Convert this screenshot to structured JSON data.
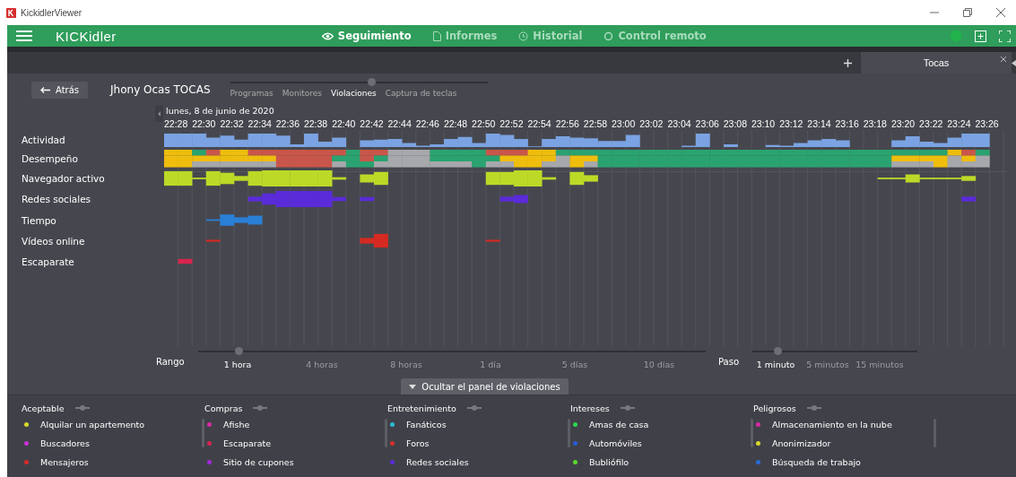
{
  "window": {
    "title": "KickidlerViewer"
  },
  "app_bar": {
    "logo": "KICKidler",
    "nav": [
      {
        "label": "Seguimiento",
        "selected": true,
        "kind": "eye"
      },
      {
        "label": "Informes",
        "selected": false,
        "kind": "doc"
      },
      {
        "label": "Historial",
        "selected": false,
        "kind": "history"
      },
      {
        "label": "Control remoto",
        "selected": false,
        "kind": "remote"
      }
    ]
  },
  "tabs": [
    {
      "label": "Tocas",
      "selected": true
    }
  ],
  "toolbar": {
    "back": "Atrás",
    "employee": "Jhony Ocas TOCAS",
    "view": {
      "level": 0.55,
      "options": [
        {
          "label": "Programas",
          "selected": false
        },
        {
          "label": "Monitores",
          "selected": false
        },
        {
          "label": "Violaciones",
          "selected": true
        },
        {
          "label": "Captura de teclas",
          "selected": false
        }
      ]
    }
  },
  "timeline": {
    "date": "lunes, 8 de junio de 2020",
    "times": [
      "22:28",
      "22:30",
      "22:32",
      "22:34",
      "22:36",
      "22:38",
      "22:40",
      "22:42",
      "22:44",
      "22:46",
      "22:48",
      "22:50",
      "22:52",
      "22:54",
      "22:56",
      "22:58",
      "23:00",
      "23:02",
      "23:04",
      "23:06",
      "23:08",
      "23:10",
      "23:12",
      "23:14",
      "23:16",
      "23:18",
      "23:20",
      "23:22",
      "23:24",
      "23:26"
    ],
    "lanes": [
      {
        "label": "Actividad",
        "kind": "activity"
      },
      {
        "label": "Desempeño",
        "kind": "performance"
      },
      {
        "label": "Navegador activo",
        "kind": "category",
        "color": "#bcd927"
      },
      {
        "label": "Redes sociales",
        "kind": "category",
        "color": "#5a2bd8"
      },
      {
        "label": "Tiempo",
        "kind": "category",
        "color": "#2a7fd6"
      },
      {
        "label": "Vídeos online",
        "kind": "category",
        "color": "#d42a22"
      },
      {
        "label": "Escaparate",
        "kind": "category",
        "color": "#d8244e"
      }
    ]
  },
  "range": {
    "label": "Rango",
    "level": 0.08,
    "options": [
      {
        "label": "1 hora",
        "selected": true
      },
      {
        "label": "4 horas",
        "selected": false
      },
      {
        "label": "8 horas",
        "selected": false
      },
      {
        "label": "1 día",
        "selected": false
      },
      {
        "label": "5 días",
        "selected": false
      },
      {
        "label": "10 días",
        "selected": false
      }
    ]
  },
  "step": {
    "label": "Paso",
    "level": 0.15,
    "options": [
      {
        "label": "1 minuto",
        "selected": true
      },
      {
        "label": "5 minutos",
        "selected": false
      },
      {
        "label": "15 minutos",
        "selected": false
      }
    ]
  },
  "panel_toggle": "Ocultar el panel de violaciones",
  "groups": [
    {
      "title": "Aceptable",
      "on": false,
      "items": [
        {
          "label": "Alquilar un apartemento",
          "color": "#d8d82a"
        },
        {
          "label": "Buscadores",
          "color": "#c832d8"
        },
        {
          "label": "Mensajeros",
          "color": "#d82a2a"
        }
      ]
    },
    {
      "title": "Compras",
      "on": false,
      "items": [
        {
          "label": "Afishe",
          "color": "#d82aa8"
        },
        {
          "label": "Escaparate",
          "color": "#d8244e"
        },
        {
          "label": "Sitio de cupones",
          "color": "#a02ad8"
        }
      ]
    },
    {
      "title": "Entretenimiento",
      "on": false,
      "items": [
        {
          "label": "Fanáticos",
          "color": "#2ab8d8"
        },
        {
          "label": "Foros",
          "color": "#d83030"
        },
        {
          "label": "Redes sociales",
          "color": "#5a2bd8"
        }
      ]
    },
    {
      "title": "Intereses",
      "on": false,
      "items": [
        {
          "label": "Amas de casa",
          "color": "#2ad850"
        },
        {
          "label": "Automóviles",
          "color": "#2a5ad8"
        },
        {
          "label": "Bubliófilo",
          "color": "#5ad82a"
        }
      ]
    },
    {
      "title": "Peligrosos",
      "on": false,
      "items": [
        {
          "label": "Almacenamiento en la nube",
          "color": "#d82aa8"
        },
        {
          "label": "Anonimizador",
          "color": "#d8d82a"
        },
        {
          "label": "Búsqueda de trabajo",
          "color": "#2a6ad8"
        }
      ]
    }
  ]
}
